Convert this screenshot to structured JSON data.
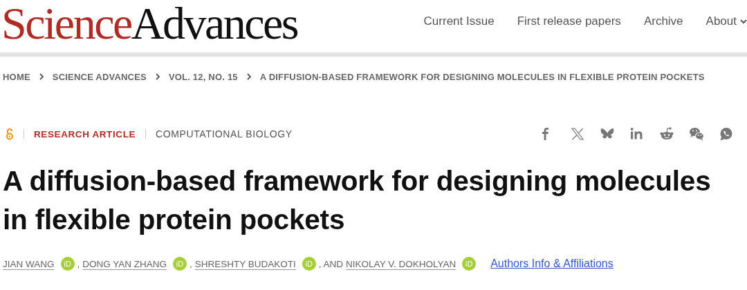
{
  "header": {
    "logo": {
      "part1": "Science",
      "part2": "Advances"
    },
    "nav": [
      {
        "label": "Current Issue",
        "has_menu": false
      },
      {
        "label": "First release papers",
        "has_menu": false
      },
      {
        "label": "Archive",
        "has_menu": false
      },
      {
        "label": "About",
        "has_menu": true
      }
    ]
  },
  "breadcrumb": [
    "HOME",
    "SCIENCE ADVANCES",
    "VOL. 12, NO. 15",
    "A DIFFUSION-BASED FRAMEWORK FOR DESIGNING MOLECULES IN FLEXIBLE PROTEIN POCKETS"
  ],
  "article": {
    "open_access": true,
    "type": "RESEARCH ARTICLE",
    "subject": "COMPUTATIONAL BIOLOGY",
    "share": [
      {
        "kind": "facebook"
      },
      {
        "kind": "x"
      },
      {
        "kind": "bluesky"
      },
      {
        "kind": "linkedin"
      },
      {
        "kind": "reddit"
      },
      {
        "kind": "wechat"
      },
      {
        "kind": "whatsapp"
      }
    ],
    "title": "A diffusion-based framework for designing molecules in flexible protein pockets",
    "authors": [
      {
        "name": "JIAN WANG",
        "badge": "iD"
      },
      {
        "prefix": ",",
        "name": "DONG YAN ZHANG",
        "badge": "iD"
      },
      {
        "prefix": ",",
        "name": "SHRESHTY BUDAKOTI",
        "badge": "iD"
      },
      {
        "prefix": ", AND",
        "name": "NIKOLAY V. DOKHOLYAN",
        "badge": "iD"
      }
    ],
    "affiliations_link": "Authors Info & Affiliations"
  }
}
